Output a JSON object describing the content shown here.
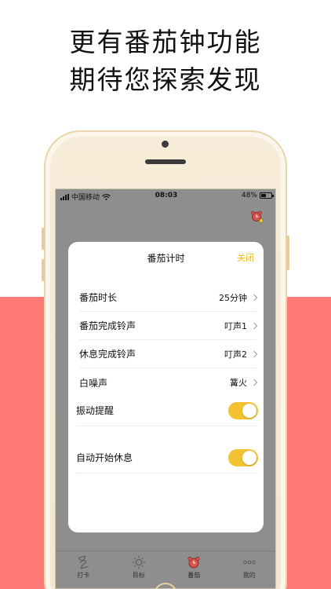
{
  "headline": {
    "line1": "更有番茄钟功能",
    "line2": "期待您探索发现"
  },
  "status_bar": {
    "carrier": "中国移动",
    "time": "08:03",
    "battery": "48%",
    "battery_level": 0.48
  },
  "modal": {
    "title": "番茄计时",
    "close_label": "关闭",
    "rows": [
      {
        "label": "番茄时长",
        "value": "25分钟"
      },
      {
        "label": "番茄完成铃声",
        "value": "叮声1"
      },
      {
        "label": "休息完成铃声",
        "value": "叮声2"
      },
      {
        "label": "白噪声",
        "value": "篝火"
      }
    ],
    "toggles": [
      {
        "label": "振动提醒",
        "on": true
      },
      {
        "label": "自动开始休息",
        "on": true
      }
    ]
  },
  "tabs": [
    {
      "label": "打卡",
      "icon": "hourglass-icon"
    },
    {
      "label": "目标",
      "icon": "sun-icon"
    },
    {
      "label": "番茄",
      "icon": "alarm-clock-icon",
      "active": true
    },
    {
      "label": "我的",
      "icon": "more-dots-icon"
    }
  ],
  "colors": {
    "accent": "#f5b800",
    "toggle_on": "#f2c230",
    "band": "#ff7a76",
    "tomato": "#d9534f"
  }
}
